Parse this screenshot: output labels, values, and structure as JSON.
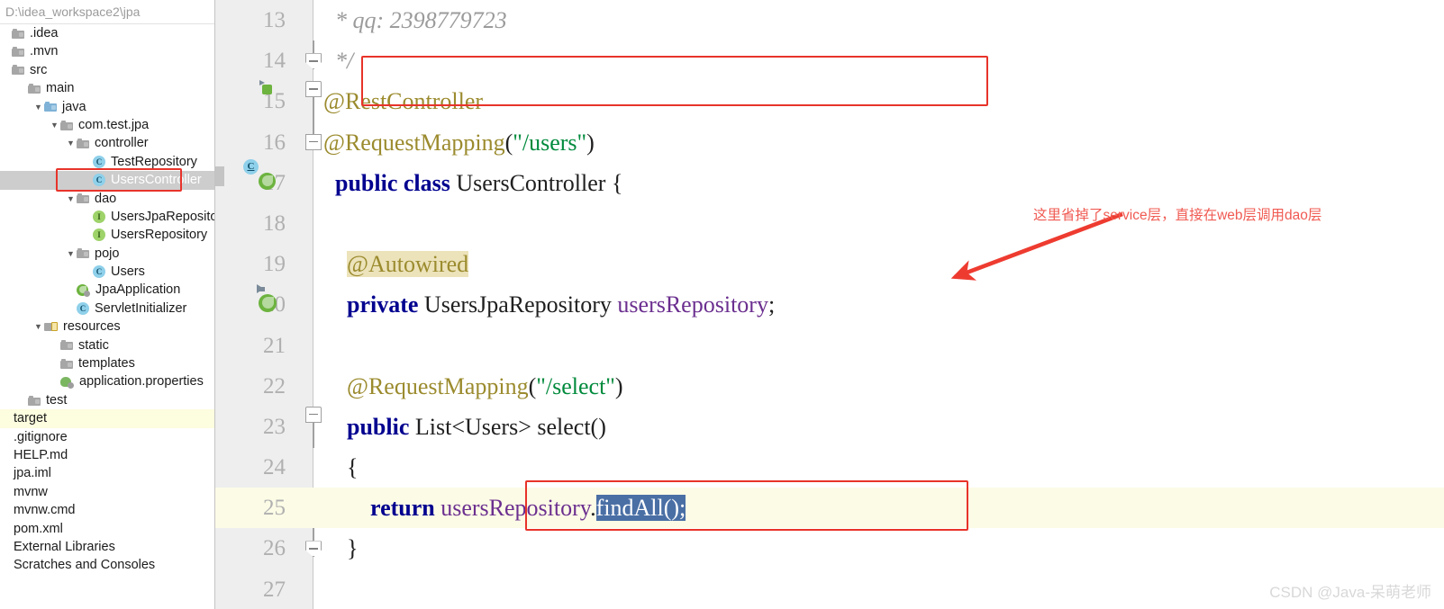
{
  "project_tree": {
    "path_label": "D:\\idea_workspace2\\jpa",
    "items": [
      {
        "label": ".idea",
        "icon": "folder-icon",
        "depth": 0,
        "chevron": "",
        "state": "clipped"
      },
      {
        "label": ".mvn",
        "icon": "folder-icon",
        "depth": 0,
        "chevron": "",
        "state": "clipped"
      },
      {
        "label": "src",
        "icon": "folder-icon",
        "depth": 0,
        "chevron": "",
        "state": "clipped"
      },
      {
        "label": "main",
        "icon": "folder-icon",
        "depth": 1,
        "chevron": "",
        "state": "normal"
      },
      {
        "label": "java",
        "icon": "source-folder-icon",
        "depth": 2,
        "chevron": "v",
        "state": "normal"
      },
      {
        "label": "com.test.jpa",
        "icon": "package-folder-icon",
        "depth": 3,
        "chevron": "v",
        "state": "normal"
      },
      {
        "label": "controller",
        "icon": "package-folder-icon",
        "depth": 4,
        "chevron": "v",
        "state": "normal"
      },
      {
        "label": "TestRepository",
        "icon": "java-class-icon",
        "depth": 5,
        "chevron": "",
        "state": "normal"
      },
      {
        "label": "UsersController",
        "icon": "java-class-icon",
        "depth": 5,
        "chevron": "",
        "state": "selected"
      },
      {
        "label": "dao",
        "icon": "package-folder-icon",
        "depth": 4,
        "chevron": "v",
        "state": "normal"
      },
      {
        "label": "UsersJpaRepository",
        "icon": "java-interface-icon",
        "depth": 5,
        "chevron": "",
        "state": "normal"
      },
      {
        "label": "UsersRepository",
        "icon": "java-interface-icon",
        "depth": 5,
        "chevron": "",
        "state": "normal"
      },
      {
        "label": "pojo",
        "icon": "package-folder-icon",
        "depth": 4,
        "chevron": "v",
        "state": "normal"
      },
      {
        "label": "Users",
        "icon": "java-class-icon",
        "depth": 5,
        "chevron": "",
        "state": "normal"
      },
      {
        "label": "JpaApplication",
        "icon": "spring-boot-icon",
        "depth": 4,
        "chevron": "",
        "state": "normal"
      },
      {
        "label": "ServletInitializer",
        "icon": "java-class-icon",
        "depth": 4,
        "chevron": "",
        "state": "normal"
      },
      {
        "label": "resources",
        "icon": "resource-folder-icon",
        "depth": 2,
        "chevron": "v",
        "state": "normal"
      },
      {
        "label": "static",
        "icon": "folder-icon",
        "depth": 3,
        "chevron": "",
        "state": "normal"
      },
      {
        "label": "templates",
        "icon": "folder-icon",
        "depth": 3,
        "chevron": "",
        "state": "normal"
      },
      {
        "label": "application.properties",
        "icon": "spring-properties-icon",
        "depth": 3,
        "chevron": "",
        "state": "normal"
      },
      {
        "label": "test",
        "icon": "folder-icon",
        "depth": 1,
        "chevron": "",
        "state": "normal"
      },
      {
        "label": "target",
        "icon": "",
        "depth": 0,
        "chevron": "",
        "state": "excluded"
      },
      {
        "label": ".gitignore",
        "icon": "",
        "depth": 0,
        "chevron": "",
        "state": "clipped"
      },
      {
        "label": "HELP.md",
        "icon": "",
        "depth": 0,
        "chevron": "",
        "state": "clipped"
      },
      {
        "label": "jpa.iml",
        "icon": "",
        "depth": 0,
        "chevron": "",
        "state": "clipped"
      },
      {
        "label": "mvnw",
        "icon": "",
        "depth": 0,
        "chevron": "",
        "state": "clipped"
      },
      {
        "label": "mvnw.cmd",
        "icon": "",
        "depth": 0,
        "chevron": "",
        "state": "clipped"
      },
      {
        "label": "pom.xml",
        "icon": "",
        "depth": 0,
        "chevron": "",
        "state": "clipped"
      },
      {
        "label": "External Libraries",
        "icon": "",
        "depth": 0,
        "chevron": "",
        "state": "clipped"
      },
      {
        "label": "Scratches and Consoles",
        "icon": "",
        "depth": 0,
        "chevron": "",
        "state": "clipped"
      }
    ]
  },
  "editor": {
    "lines": [
      {
        "number": "13",
        "caret": false,
        "gutter_icon": "",
        "fold": "",
        "segments": [
          {
            "t": "  * qq: 2398779723",
            "c": "cmt"
          }
        ]
      },
      {
        "number": "14",
        "caret": false,
        "gutter_icon": "",
        "fold": "bottom",
        "segments": [
          {
            "t": "  */",
            "c": "cmt"
          }
        ]
      },
      {
        "number": "15",
        "caret": false,
        "gutter_icon": "spring-bean-small",
        "fold": "top",
        "segments": [
          {
            "t": "@RestController",
            "c": "anno"
          }
        ]
      },
      {
        "number": "16",
        "caret": false,
        "gutter_icon": "",
        "fold": "point",
        "segments": [
          {
            "t": "@RequestMapping",
            "c": "anno"
          },
          {
            "t": "(",
            "c": ""
          },
          {
            "t": "\"/users\"",
            "c": "str"
          },
          {
            "t": ")",
            "c": ""
          }
        ]
      },
      {
        "number": "17",
        "caret": false,
        "gutter_icon": "spring-class",
        "fold": "",
        "segments": [
          {
            "t": "  ",
            "c": ""
          },
          {
            "t": "public class",
            "c": "kw"
          },
          {
            "t": " UsersController {",
            "c": ""
          }
        ]
      },
      {
        "number": "18",
        "caret": false,
        "gutter_icon": "",
        "fold": "",
        "segments": []
      },
      {
        "number": "19",
        "caret": false,
        "gutter_icon": "",
        "fold": "",
        "segments": [
          {
            "t": "    ",
            "c": ""
          },
          {
            "t": "@Autowired",
            "c": "anno hl-anno"
          }
        ]
      },
      {
        "number": "20",
        "caret": false,
        "gutter_icon": "spring-bean-arrow",
        "fold": "",
        "segments": [
          {
            "t": "    ",
            "c": ""
          },
          {
            "t": "private",
            "c": "kw"
          },
          {
            "t": " UsersJpaRepository ",
            "c": ""
          },
          {
            "t": "usersRepository",
            "c": "field"
          },
          {
            "t": ";",
            "c": ""
          }
        ]
      },
      {
        "number": "21",
        "caret": false,
        "gutter_icon": "",
        "fold": "",
        "segments": []
      },
      {
        "number": "22",
        "caret": false,
        "gutter_icon": "",
        "fold": "",
        "segments": [
          {
            "t": "    ",
            "c": ""
          },
          {
            "t": "@RequestMapping",
            "c": "anno"
          },
          {
            "t": "(",
            "c": ""
          },
          {
            "t": "\"/select\"",
            "c": "str"
          },
          {
            "t": ")",
            "c": ""
          }
        ]
      },
      {
        "number": "23",
        "caret": false,
        "gutter_icon": "",
        "fold": "top",
        "segments": [
          {
            "t": "    ",
            "c": ""
          },
          {
            "t": "public",
            "c": "kw"
          },
          {
            "t": " List<Users> select()",
            "c": ""
          }
        ]
      },
      {
        "number": "24",
        "caret": false,
        "gutter_icon": "",
        "fold": "",
        "segments": [
          {
            "t": "    {",
            "c": ""
          }
        ]
      },
      {
        "number": "25",
        "caret": true,
        "gutter_icon": "",
        "fold": "",
        "segments": [
          {
            "t": "        ",
            "c": ""
          },
          {
            "t": "return",
            "c": "kw"
          },
          {
            "t": " ",
            "c": ""
          },
          {
            "t": "usersRepository",
            "c": "field"
          },
          {
            "t": ".",
            "c": ""
          },
          {
            "t": "findAll();",
            "c": "sel"
          }
        ]
      },
      {
        "number": "26",
        "caret": false,
        "gutter_icon": "",
        "fold": "bottom",
        "segments": [
          {
            "t": "    }",
            "c": ""
          }
        ]
      },
      {
        "number": "27",
        "caret": false,
        "gutter_icon": "",
        "fold": "",
        "segments": []
      }
    ]
  },
  "annotations": {
    "note_text": "这里省掉了service层，直接在web层调用dao层",
    "accent_color": "#e8332a",
    "note_color": "#f05a52"
  },
  "watermark": {
    "text": "CSDN @Java-呆萌老师"
  }
}
